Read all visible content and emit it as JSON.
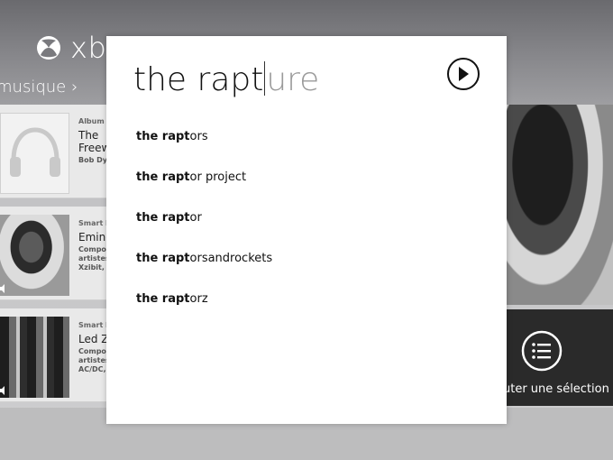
{
  "app": {
    "brand_text": "xb",
    "section_label": "musique"
  },
  "cards": [
    {
      "type": "Album",
      "title": "The Freew",
      "sub": "Bob Dyl"
    },
    {
      "type": "Smart D",
      "title": "Emine",
      "sub": "Compor artistes Xzibit, K"
    },
    {
      "type": "Smart D",
      "title": "Led Z",
      "sub": "Compor artistes AC/DC,"
    }
  ],
  "tile": {
    "label": "uter une sélection"
  },
  "search": {
    "typed": "the rapt",
    "ghost": "ure",
    "suggestions": [
      {
        "bold": "the rapt",
        "rest": "ors"
      },
      {
        "bold": "the rapt",
        "rest": "or project"
      },
      {
        "bold": "the rapt",
        "rest": "or"
      },
      {
        "bold": "the rapt",
        "rest": "orsandrockets"
      },
      {
        "bold": "the rapt",
        "rest": "orz"
      }
    ]
  },
  "icons": {
    "brand": "xbox-logo-icon",
    "go": "play-arrow-icon",
    "tile": "list-icon"
  }
}
